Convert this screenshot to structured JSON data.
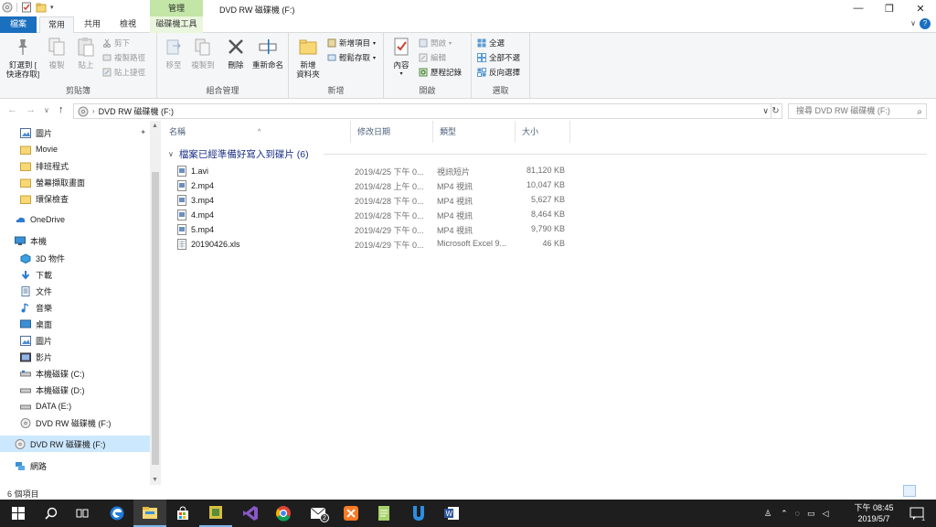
{
  "window": {
    "title": "DVD RW 磁碟機 (F:)",
    "context_tab_header": "管理",
    "minimize_glyph": "—",
    "maximize_glyph": "❐",
    "close_glyph": "✕"
  },
  "tabs": {
    "file": "檔案",
    "home": "常用",
    "share": "共用",
    "view": "檢視",
    "drive_tools": "磁碟機工具",
    "collapse_glyph": "∨",
    "help_glyph": "?"
  },
  "ribbon": {
    "clipboard": {
      "label": "剪貼簿",
      "pin": "釘選到 [\n快速存取]",
      "copy": "複製",
      "paste": "貼上",
      "cut": "剪下",
      "copy_path": "複製路徑",
      "paste_shortcut": "貼上捷徑"
    },
    "organize": {
      "label": "組合管理",
      "move_to": "移至",
      "copy_to": "複製到",
      "delete": "刪除",
      "rename": "重新命名"
    },
    "new": {
      "label": "新增",
      "new_folder": "新增\n資料夾",
      "new_item": "新增項目",
      "easy_access": "輕鬆存取"
    },
    "open": {
      "label": "開啟",
      "properties": "內容",
      "open": "開啟",
      "edit": "編輯",
      "history": "歷程記錄"
    },
    "select": {
      "label": "選取",
      "select_all": "全選",
      "select_none": "全部不選",
      "invert": "反向選擇"
    }
  },
  "address": {
    "back_glyph": "←",
    "forward_glyph": "→",
    "recent_glyph": "∨",
    "up_glyph": "↑",
    "path": "DVD RW 磁碟機 (F:)",
    "drop_glyph": "∨",
    "refresh_glyph": "↻",
    "search_placeholder": "搜尋 DVD RW 磁碟機 (F:)",
    "search_glyph": "⌕"
  },
  "nav": {
    "pin_glyph": "✦",
    "items": [
      {
        "label": "圖片",
        "icon": "pictures-icon"
      },
      {
        "label": "Movie",
        "icon": "folder-icon"
      },
      {
        "label": "排班程式",
        "icon": "folder-icon"
      },
      {
        "label": "螢幕擷取畫面",
        "icon": "folder-icon"
      },
      {
        "label": "環保檢查",
        "icon": "folder-icon"
      },
      {
        "label": "OneDrive",
        "icon": "onedrive-icon"
      },
      {
        "label": "本機",
        "icon": "this-pc-icon"
      },
      {
        "label": "3D 物件",
        "icon": "3d-objects-icon"
      },
      {
        "label": "下載",
        "icon": "downloads-icon"
      },
      {
        "label": "文件",
        "icon": "documents-icon"
      },
      {
        "label": "音樂",
        "icon": "music-icon"
      },
      {
        "label": "桌面",
        "icon": "desktop-icon"
      },
      {
        "label": "圖片",
        "icon": "pictures-icon"
      },
      {
        "label": "影片",
        "icon": "videos-icon"
      },
      {
        "label": "本機磁碟 (C:)",
        "icon": "drive-icon"
      },
      {
        "label": "本機磁碟 (D:)",
        "icon": "drive-icon"
      },
      {
        "label": "DATA (E:)",
        "icon": "drive-icon"
      },
      {
        "label": "DVD RW 磁碟機 (F:)",
        "icon": "dvd-drive-icon"
      },
      {
        "label": "DVD RW 磁碟機 (F:)",
        "icon": "dvd-drive-icon"
      },
      {
        "label": "網路",
        "icon": "network-icon"
      }
    ]
  },
  "list": {
    "columns": {
      "name": "名稱",
      "date": "修改日期",
      "type": "類型",
      "size": "大小"
    },
    "sort_glyph": "^",
    "group_glyph": "∨",
    "group_header": "檔案已經準備好寫入到碟片 (6)",
    "files": [
      {
        "name": "1.avi",
        "date": "2019/4/25 下午 0...",
        "type": "視訊短片",
        "size": "81,120 KB"
      },
      {
        "name": "2.mp4",
        "date": "2019/4/28 上午 0...",
        "type": "MP4 視訊",
        "size": "10,047 KB"
      },
      {
        "name": "3.mp4",
        "date": "2019/4/28 下午 0...",
        "type": "MP4 視訊",
        "size": "5,627 KB"
      },
      {
        "name": "4.mp4",
        "date": "2019/4/28 下午 0...",
        "type": "MP4 視訊",
        "size": "8,464 KB"
      },
      {
        "name": "5.mp4",
        "date": "2019/4/29 下午 0...",
        "type": "MP4 視訊",
        "size": "9,790 KB"
      },
      {
        "name": "20190426.xls",
        "date": "2019/4/29 下午 0...",
        "type": "Microsoft Excel 9...",
        "size": "46 KB"
      }
    ]
  },
  "status": {
    "item_count": "6 個項目"
  },
  "taskbar": {
    "apps": [
      "start-icon",
      "search-icon",
      "task-view-icon",
      "edge-icon",
      "file-explorer-icon",
      "store-icon",
      "app-icon",
      "visual-studio-icon",
      "chrome-icon",
      "mail-icon",
      "xampp-icon",
      "notepad-icon",
      "u-app-icon",
      "word-icon"
    ],
    "mail_badge": "2",
    "time": "下午 08:45",
    "date": "2019/5/7",
    "notification_count": "1"
  },
  "colors": {
    "accent": "#1a6fbf",
    "context_tab": "#c3e6a6",
    "selection": "#cce8ff",
    "group_header": "#1e3287",
    "taskbar": "#1e1e1e"
  }
}
